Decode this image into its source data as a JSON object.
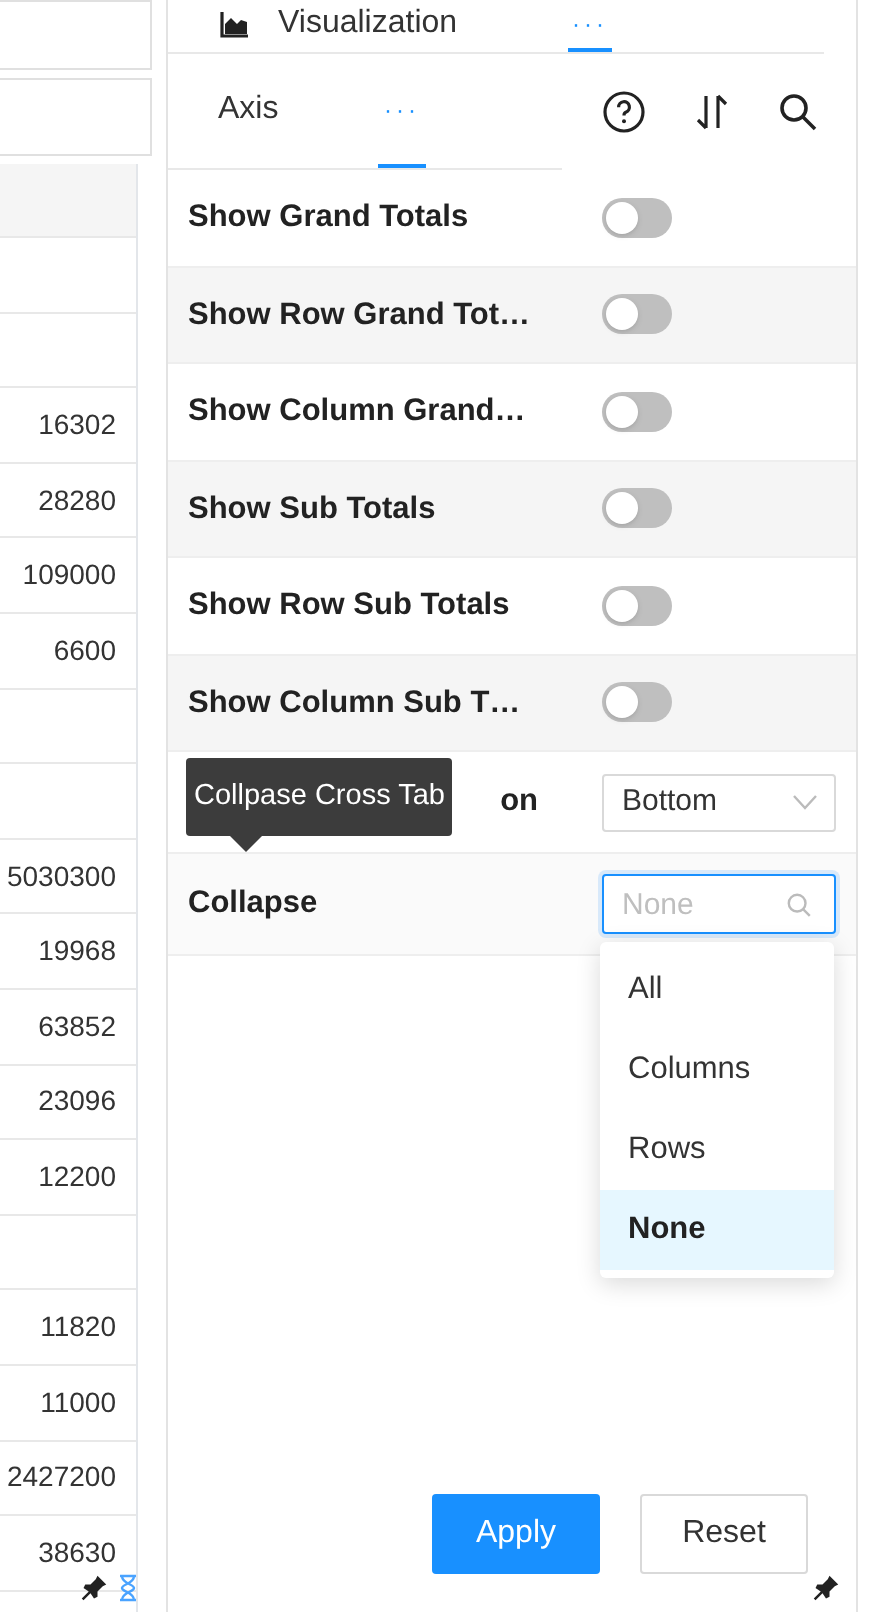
{
  "left_table": {
    "rows": [
      {
        "kind": "blank"
      },
      {
        "kind": "blank"
      },
      {
        "kind": "value",
        "value": "16302"
      },
      {
        "kind": "value",
        "value": "28280"
      },
      {
        "kind": "value",
        "value": "109000"
      },
      {
        "kind": "value",
        "value": "6600"
      },
      {
        "kind": "blank"
      },
      {
        "kind": "blank"
      },
      {
        "kind": "value",
        "value": "5030300"
      },
      {
        "kind": "value",
        "value": "19968"
      },
      {
        "kind": "value",
        "value": "63852"
      },
      {
        "kind": "value",
        "value": "23096"
      },
      {
        "kind": "value",
        "value": "12200"
      },
      {
        "kind": "blank"
      },
      {
        "kind": "value",
        "value": "11820"
      },
      {
        "kind": "value",
        "value": "11000"
      },
      {
        "kind": "value",
        "value": "2427200"
      },
      {
        "kind": "value",
        "value": "38630"
      }
    ]
  },
  "top_tabs": [
    {
      "label": "Visualization",
      "kind": "text",
      "selected": false
    },
    {
      "label": "···",
      "kind": "more",
      "selected": true
    }
  ],
  "sub_tabs": [
    {
      "label": "Axis",
      "kind": "text",
      "selected": false
    },
    {
      "label": "···",
      "kind": "more",
      "selected": true
    }
  ],
  "settings": [
    {
      "kind": "toggle",
      "label": "Show Grand Totals",
      "on": false
    },
    {
      "kind": "toggle",
      "label": "Show Row Grand Tot…",
      "on": false
    },
    {
      "kind": "toggle",
      "label": "Show Column Grand…",
      "on": false
    },
    {
      "kind": "toggle",
      "label": "Show Sub Totals",
      "on": false
    },
    {
      "kind": "toggle",
      "label": "Show Row Sub Totals",
      "on": false
    },
    {
      "kind": "toggle",
      "label": "Show Column Sub T…",
      "on": false
    },
    {
      "kind": "select",
      "label": "on",
      "covered": true,
      "value": "Bottom"
    },
    {
      "kind": "search_select",
      "label": "Collapse",
      "covered": false,
      "placeholder": "None"
    }
  ],
  "tooltip": "Collpase Cross Tab",
  "collapse_menu": [
    {
      "label": "All",
      "selected": false
    },
    {
      "label": "Columns",
      "selected": false
    },
    {
      "label": "Rows",
      "selected": false
    },
    {
      "label": "None",
      "selected": true
    }
  ],
  "buttons": [
    {
      "label": "Apply",
      "kind": "primary"
    },
    {
      "label": "Reset",
      "kind": "default"
    }
  ]
}
